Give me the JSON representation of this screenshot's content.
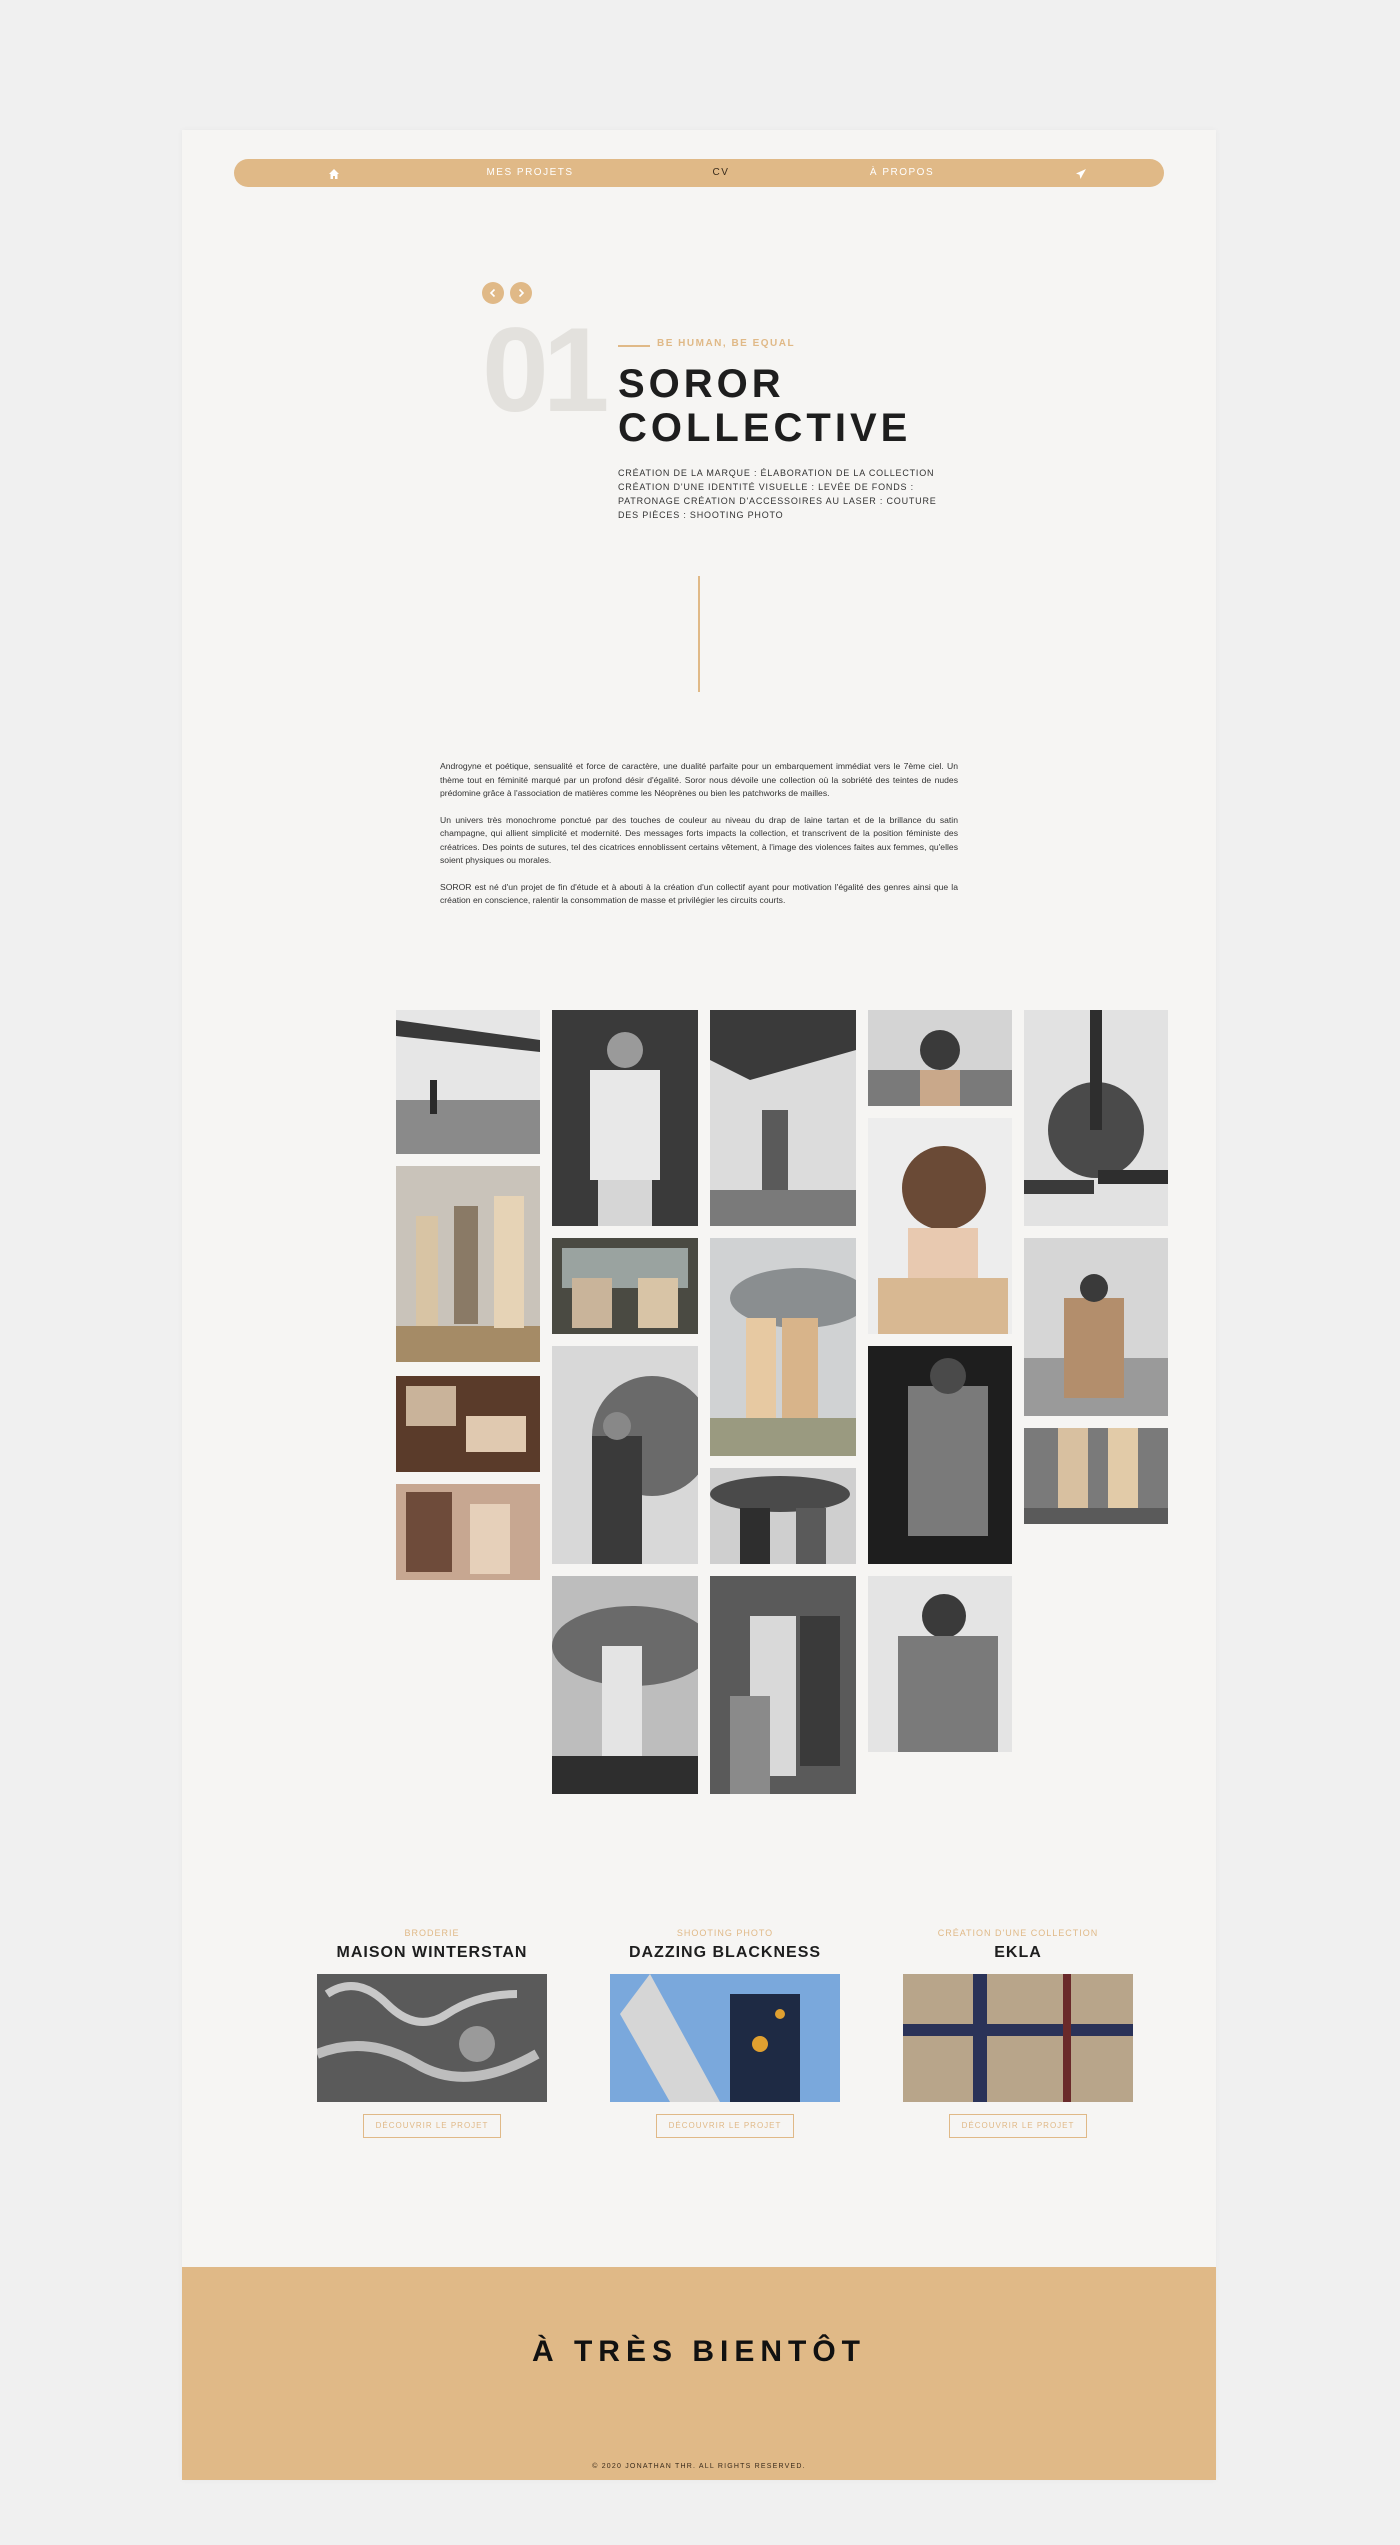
{
  "nav": {
    "items": [
      {
        "label": "Mes projets"
      },
      {
        "label": "CV"
      },
      {
        "label": "À propos"
      }
    ],
    "home_icon": "home-icon",
    "send_icon": "paper-plane-icon"
  },
  "project": {
    "number": "01",
    "tagline": "Be human, be equal",
    "title_line1": "SOROR",
    "title_line2": "COLLECTIVE",
    "services": "Création de la marque : élaboration de la collection création d'une identité visuelle : levée de fonds : patronage création d'accessoires au laser : couture des pièces : shooting photo",
    "description": [
      "Androgyne et poétique, sensualité et force de caractère, une dualité parfaite pour un embarquement immédiat vers le 7ème ciel. Un thème tout en féminité marqué par un profond désir d'égalité. Soror nous dévoile une collection où la sobriété des teintes de nudes prédomine grâce à l'association de matières comme les Néoprènes ou bien les patchworks de mailles.",
      "Un univers très monochrome ponctué par des touches de couleur au niveau du drap de laine tartan et de la brillance du satin champagne, qui allient simplicité et modernité. Des messages forts impacts la collection, et transcrivent de la position féministe des créatrices. Des points de sutures, tel des cicatrices ennoblissent certains vêtement, à l'image des violences faites aux femmes, qu'elles soient physiques ou morales.",
      "SOROR est né d'un projet de fin d'étude et à abouti à la création d'un collectif ayant pour motivation l'égalité des genres ainsi que la création en conscience, ralentir la consommation de masse et privilégier les circuits courts."
    ]
  },
  "related": [
    {
      "category": "Broderie",
      "title": "Maison Winterstan",
      "button": "Découvrir le projet"
    },
    {
      "category": "Shooting photo",
      "title": "Dazzing Blackness",
      "button": "Découvrir le projet"
    },
    {
      "category": "Création d'une collection",
      "title": "EKLA",
      "button": "Découvrir le projet"
    }
  ],
  "footer": {
    "title": "À très bientôt",
    "copyright": "© 2020 Jonathan THR. All rights reserved."
  },
  "colors": {
    "accent": "#e0b987",
    "page_bg": "#f6f5f3",
    "outer_bg": "#f0f0f0",
    "text": "#1e1e1e"
  }
}
